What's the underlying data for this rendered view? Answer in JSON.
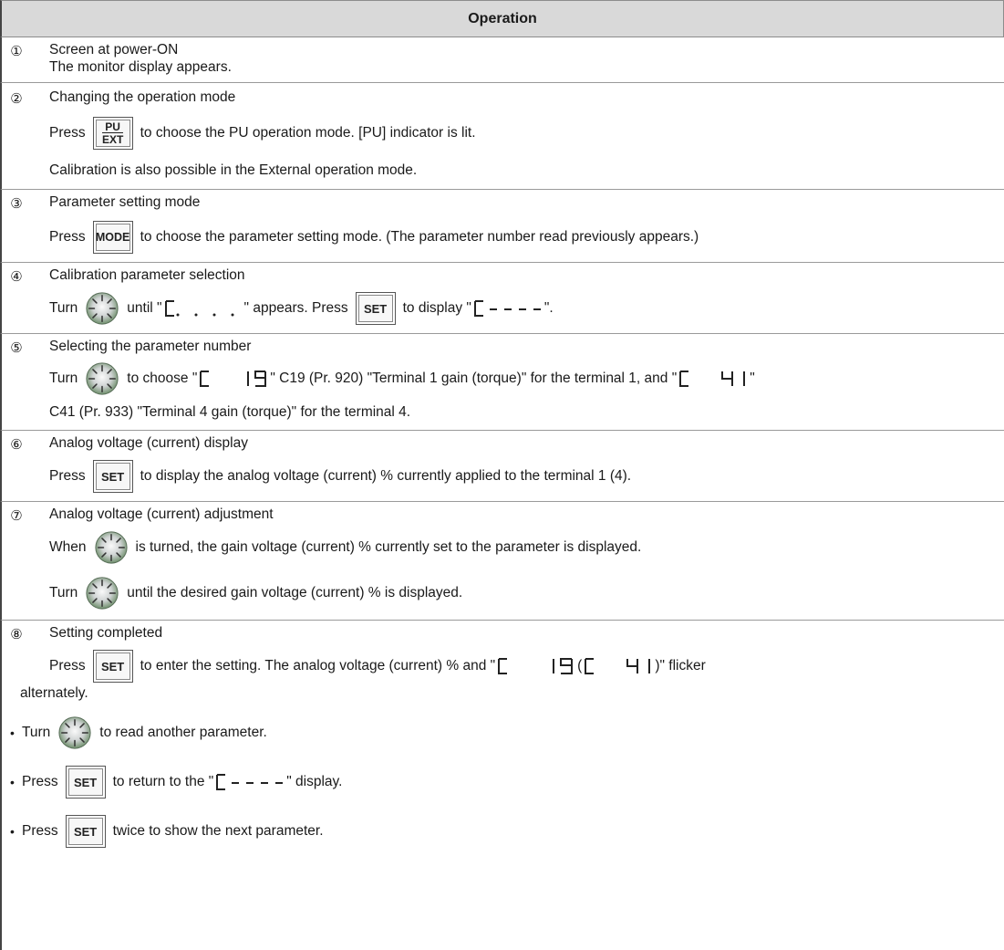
{
  "header": {
    "title": "Operation"
  },
  "glyphs": {
    "step_numbers": [
      "①",
      "②",
      "③",
      "④",
      "⑤",
      "⑥",
      "⑦",
      "⑧"
    ],
    "bullet": "•"
  },
  "icons": {
    "dial": "setting-dial-icon",
    "set_key": "SET",
    "mode_key": "MODE",
    "pu_key_top": "PU",
    "pu_key_bottom": "EXT"
  },
  "steps": {
    "s1": {
      "title": "Screen at power-ON",
      "line1": "The monitor display appears."
    },
    "s2": {
      "title": "Changing the operation mode",
      "press": "Press",
      "after": "to choose the PU operation mode. [PU] indicator is lit.",
      "line2": "Calibration is also possible in the External operation mode."
    },
    "s3": {
      "title": "Parameter setting mode",
      "press": "Press",
      "after": "to choose the parameter setting mode. (The parameter number read previously appears.)"
    },
    "s4": {
      "title": "Calibration parameter selection",
      "turn": "Turn",
      "until": "until \"",
      "appears": "\" appears. Press",
      "to_display": "to display \"",
      "close": "\"."
    },
    "s5": {
      "title": "Selecting the parameter number",
      "turn": "Turn",
      "choose": "to choose \"",
      "mid": "\" C19 (Pr. 920) \"Terminal 1 gain (torque)\" for the terminal 1, and \"",
      "close": "\"",
      "line2": "C41 (Pr. 933) \"Terminal 4 gain (torque)\" for the terminal 4."
    },
    "s6": {
      "title": "Analog voltage (current) display",
      "press": "Press",
      "after": "to display the analog voltage (current) % currently applied to the terminal 1 (4)."
    },
    "s7": {
      "title": "Analog voltage (current) adjustment",
      "when": "When",
      "turned": "is turned, the gain voltage (current) % currently set to the parameter is displayed.",
      "turn": "Turn",
      "until": "until the desired gain voltage (current) % is displayed."
    },
    "s8": {
      "title": "Setting completed",
      "press": "Press",
      "after": "to enter the setting. The analog voltage (current) % and \"",
      "paren_open": " (",
      "paren_close": ")\" flicker",
      "line2": "alternately."
    }
  },
  "bullets": {
    "b1": {
      "turn": "Turn",
      "after": "to read another parameter."
    },
    "b2": {
      "press": "Press",
      "after": "to return to the \"",
      "close": "\" display."
    },
    "b3": {
      "press": "Press",
      "after": "twice to show the next parameter."
    }
  }
}
